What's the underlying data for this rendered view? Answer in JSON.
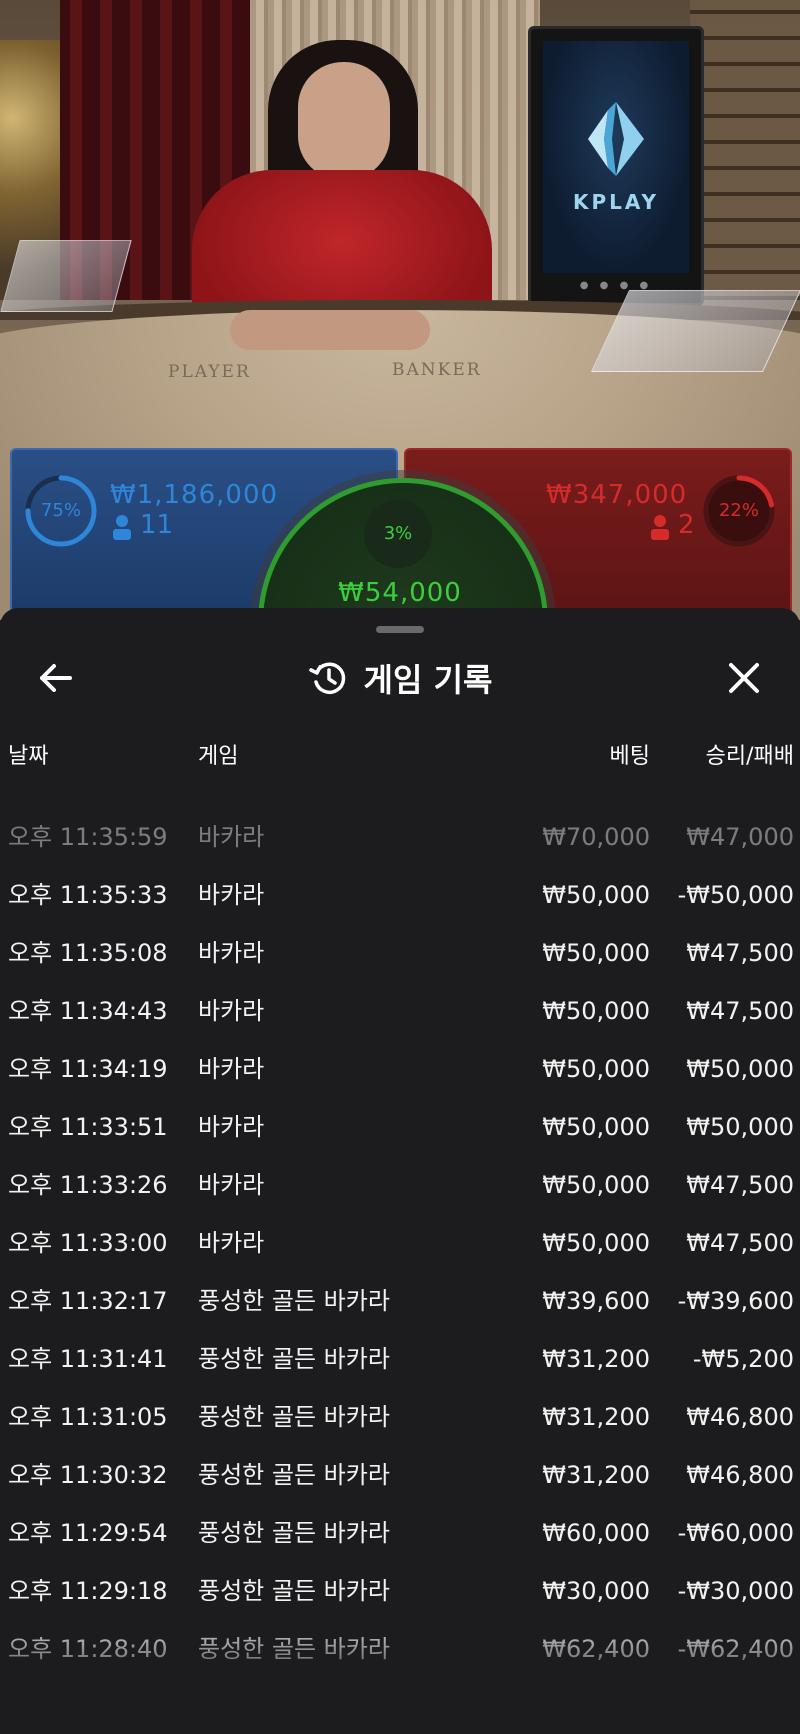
{
  "video": {
    "felt_player": "PLAYER",
    "felt_banker": "BANKER",
    "monitor_brand": "KPLAY"
  },
  "bets": {
    "player": {
      "percent": "75%",
      "percent_value": 0.75,
      "amount": "₩1,186,000",
      "players": "11",
      "color": "#2f86d8"
    },
    "banker": {
      "percent": "22%",
      "percent_value": 0.22,
      "amount": "₩347,000",
      "players": "2",
      "color": "#d62b2b"
    },
    "tie": {
      "percent": "3%",
      "percent_value": 0.03,
      "amount": "₩54,000",
      "color": "#3ccf3c"
    }
  },
  "sheet": {
    "title": "게임 기록",
    "back_icon": "arrow-left-icon",
    "title_icon": "history-icon",
    "close_icon": "close-icon",
    "columns": {
      "date": "날짜",
      "game": "게임",
      "bet": "베팅",
      "result": "승리/패배"
    },
    "rows": [
      {
        "time": "오후 11:35:59",
        "game": "바카라",
        "bet": "₩70,000",
        "result": "₩47,000"
      },
      {
        "time": "오후 11:35:33",
        "game": "바카라",
        "bet": "₩50,000",
        "result": "-₩50,000"
      },
      {
        "time": "오후 11:35:08",
        "game": "바카라",
        "bet": "₩50,000",
        "result": "₩47,500"
      },
      {
        "time": "오후 11:34:43",
        "game": "바카라",
        "bet": "₩50,000",
        "result": "₩47,500"
      },
      {
        "time": "오후 11:34:19",
        "game": "바카라",
        "bet": "₩50,000",
        "result": "₩50,000"
      },
      {
        "time": "오후 11:33:51",
        "game": "바카라",
        "bet": "₩50,000",
        "result": "₩50,000"
      },
      {
        "time": "오후 11:33:26",
        "game": "바카라",
        "bet": "₩50,000",
        "result": "₩47,500"
      },
      {
        "time": "오후 11:33:00",
        "game": "바카라",
        "bet": "₩50,000",
        "result": "₩47,500"
      },
      {
        "time": "오후 11:32:17",
        "game": "풍성한 골든 바카라",
        "bet": "₩39,600",
        "result": "-₩39,600"
      },
      {
        "time": "오후 11:31:41",
        "game": "풍성한 골든 바카라",
        "bet": "₩31,200",
        "result": "-₩5,200"
      },
      {
        "time": "오후 11:31:05",
        "game": "풍성한 골든 바카라",
        "bet": "₩31,200",
        "result": "₩46,800"
      },
      {
        "time": "오후 11:30:32",
        "game": "풍성한 골든 바카라",
        "bet": "₩31,200",
        "result": "₩46,800"
      },
      {
        "time": "오후 11:29:54",
        "game": "풍성한 골든 바카라",
        "bet": "₩60,000",
        "result": "-₩60,000"
      },
      {
        "time": "오후 11:29:18",
        "game": "풍성한 골든 바카라",
        "bet": "₩30,000",
        "result": "-₩30,000"
      },
      {
        "time": "오후 11:28:40",
        "game": "풍성한 골든 바카라",
        "bet": "₩62,400",
        "result": "-₩62,400"
      }
    ]
  }
}
